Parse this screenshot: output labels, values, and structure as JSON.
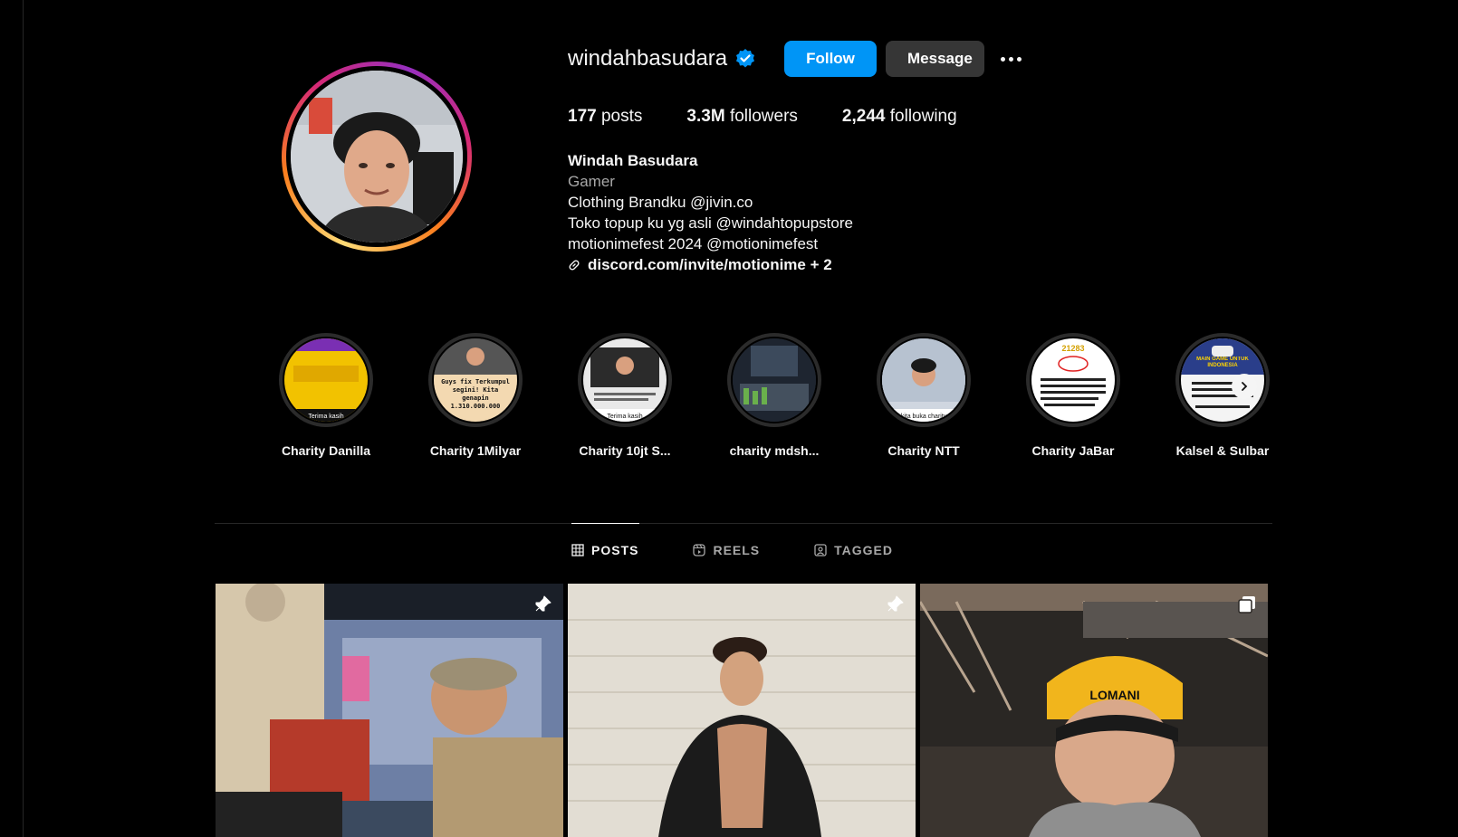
{
  "profile": {
    "username": "windahbasudara",
    "follow_label": "Follow",
    "message_label": "Message",
    "stats": {
      "posts_count": "177",
      "posts_label": "posts",
      "followers_count": "3.3M",
      "followers_label": "followers",
      "following_count": "2,244",
      "following_label": "following"
    },
    "bio": {
      "name": "Windah Basudara",
      "category": "Gamer",
      "lines": [
        "Clothing Brandku @jivin.co",
        "Toko topup ku yg asli @windahtopupstore",
        "motionimefest 2024 @motionimefest"
      ],
      "link": "discord.com/invite/motionime + 2"
    }
  },
  "highlights": [
    {
      "label": "Charity Danilla",
      "thumb_text": "Terima kasih"
    },
    {
      "label": "Charity 1Milyar",
      "thumb_text": "Guys fix Terkumpul segini! Kita genapin 1.310.000.000"
    },
    {
      "label": "Charity 10jt S...",
      "thumb_text": "Terima kasih"
    },
    {
      "label": "charity mdsh...",
      "thumb_text": ""
    },
    {
      "label": "Charity NTT",
      "thumb_text": "kita buka charity"
    },
    {
      "label": "Charity JaBar",
      "thumb_text": "21283"
    },
    {
      "label": "Kalsel & Sulbar",
      "thumb_text": "MAIN GAME UNTUK INDONESIA"
    }
  ],
  "tabs": [
    {
      "label": "POSTS",
      "icon": "grid-icon",
      "active": true
    },
    {
      "label": "REELS",
      "icon": "reels-icon",
      "active": false
    },
    {
      "label": "TAGGED",
      "icon": "tagged-icon",
      "active": false
    }
  ],
  "posts": [
    {
      "badge": "pin-icon"
    },
    {
      "badge": "pin-icon"
    },
    {
      "badge": "carousel-icon"
    }
  ],
  "posts_thumb_text": "LOMANI",
  "colors": {
    "background": "#000000",
    "follow_button": "#0095f6",
    "message_button": "#363636",
    "verified": "#0095f6",
    "secondary_text": "#a8a8a8"
  }
}
